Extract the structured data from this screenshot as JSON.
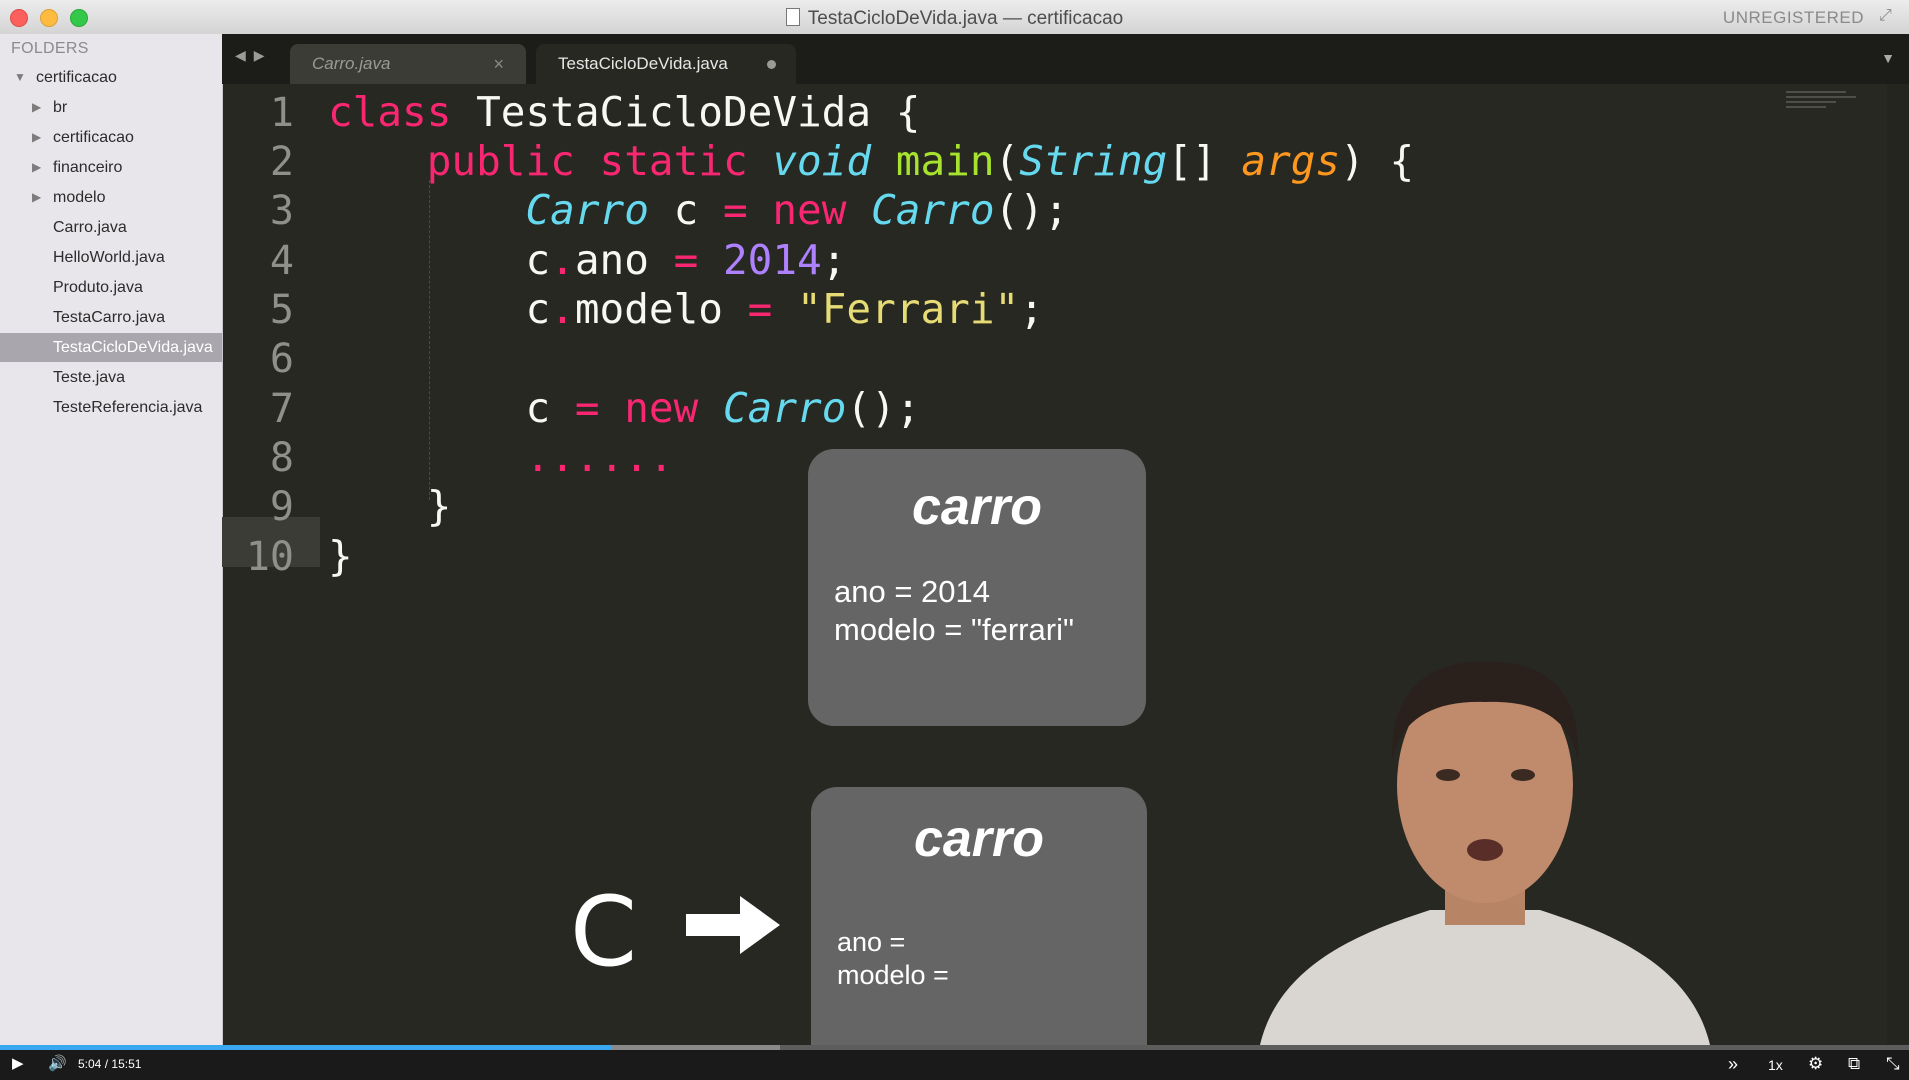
{
  "window": {
    "title": "TestaCicloDeVida.java — certificacao",
    "license": "UNREGISTERED"
  },
  "sidebar": {
    "header": "FOLDERS",
    "root": "certificacao",
    "items": [
      {
        "label": "br",
        "type": "folder"
      },
      {
        "label": "certificacao",
        "type": "folder"
      },
      {
        "label": "financeiro",
        "type": "folder"
      },
      {
        "label": "modelo",
        "type": "folder"
      },
      {
        "label": "Carro.java",
        "type": "file"
      },
      {
        "label": "HelloWorld.java",
        "type": "file"
      },
      {
        "label": "Produto.java",
        "type": "file"
      },
      {
        "label": "TestaCarro.java",
        "type": "file"
      },
      {
        "label": "TestaCicloDeVida.java",
        "type": "file",
        "selected": true
      },
      {
        "label": "Teste.java",
        "type": "file"
      },
      {
        "label": "TesteReferencia.java",
        "type": "file"
      }
    ]
  },
  "tabs": [
    {
      "label": "Carro.java",
      "close": "×",
      "active": false
    },
    {
      "label": "TestaCicloDeVida.java",
      "active": true,
      "modified": true
    }
  ],
  "editor": {
    "line_numbers": [
      "1",
      "2",
      "3",
      "4",
      "5",
      "6",
      "7",
      "8",
      "9",
      "10"
    ],
    "current_line": "8",
    "lines": [
      "class TestaCicloDeVida {",
      "    public static void main(String[] args) {",
      "        Carro c = new Carro();",
      "        c.ano = 2014;",
      "        c.modelo = \"Ferrari\";",
      "",
      "        c = new Carro();",
      "        ......",
      "    }",
      "}"
    ]
  },
  "overlay": {
    "box1": {
      "title": "carro",
      "field1": "ano = 2014",
      "field2": "modelo = \"ferrari\""
    },
    "box2": {
      "title": "carro",
      "field1": "ano =",
      "field2": "modelo ="
    },
    "variable": "C"
  },
  "player": {
    "current_time": "5:04",
    "separator": "/",
    "duration": "15:51",
    "speed": "1x",
    "progress_fraction": 0.32
  },
  "colors": {
    "keyword": "#f92672",
    "type": "#66d9ef",
    "function": "#a6e22e",
    "param": "#fd971f",
    "number": "#ae81ff",
    "string": "#e6db74",
    "editor_bg": "#272822",
    "progress": "#3aa8f0"
  }
}
